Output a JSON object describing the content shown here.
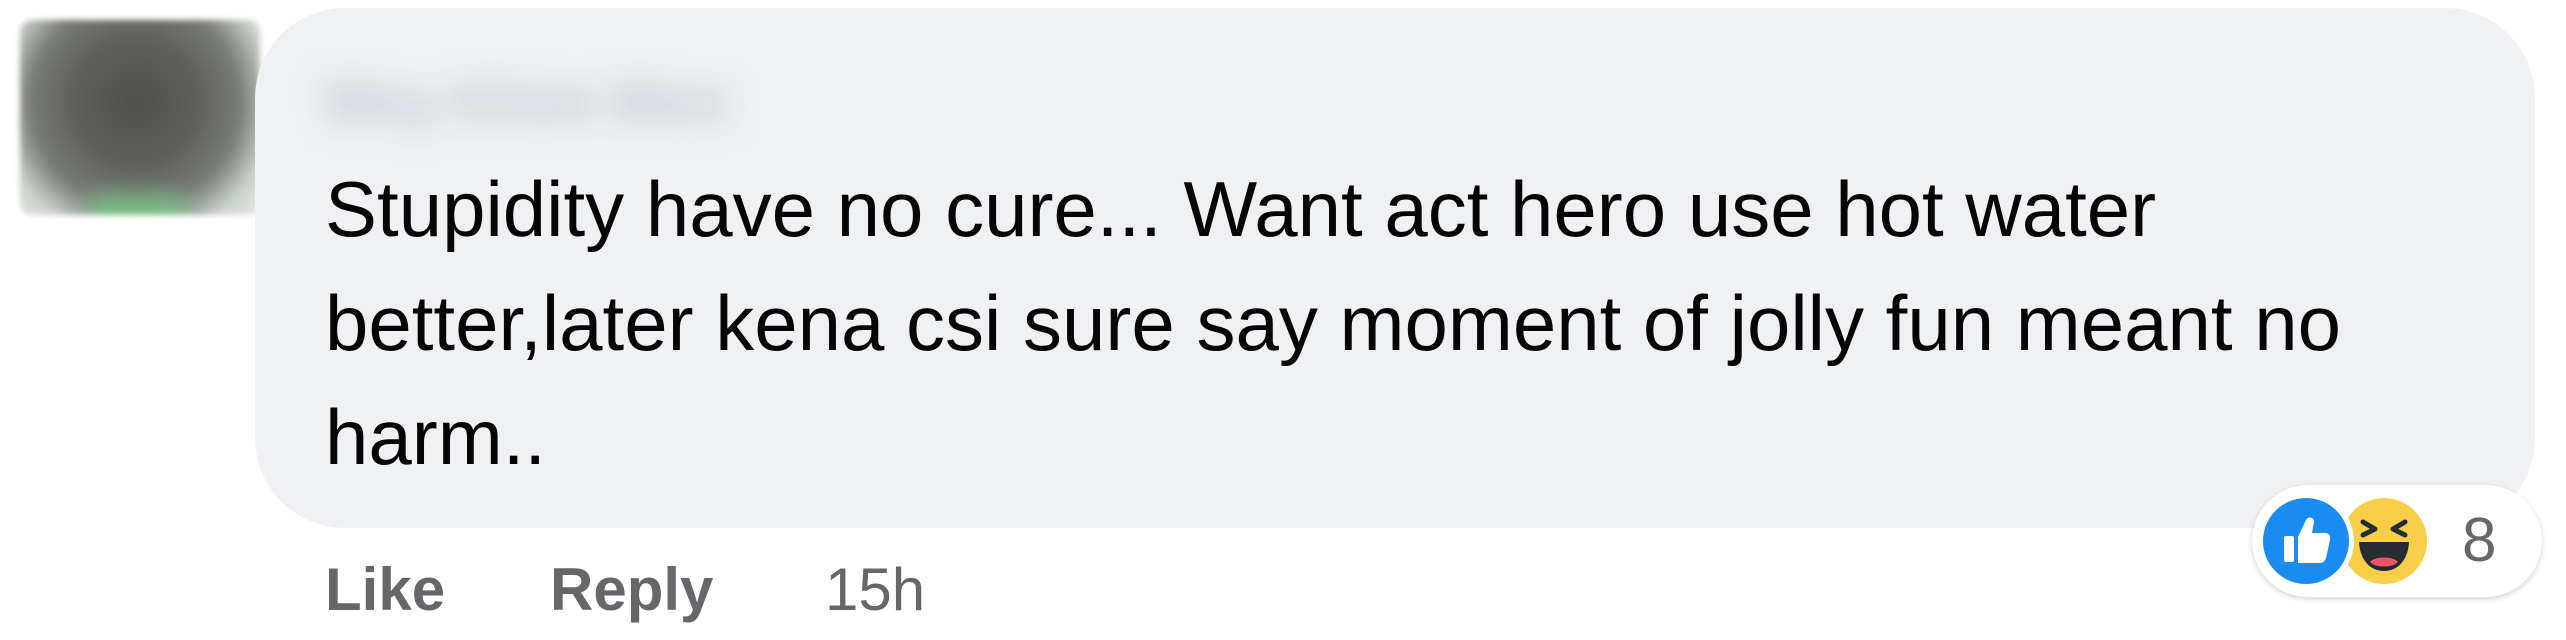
{
  "comment": {
    "author_name": "Wey Khim Wen",
    "text": "Stupidity have no cure... Want act hero use hot water better,later kena csi sure say moment of jolly fun meant no harm..",
    "actions": {
      "like_label": "Like",
      "reply_label": "Reply",
      "timestamp": "15h"
    },
    "reactions": {
      "types": [
        "like-icon",
        "haha-icon"
      ],
      "count": "8"
    }
  },
  "colors": {
    "bubble": "#eff1f4",
    "text": "#050505",
    "secondary_text": "#65676b",
    "like_blue": "#1b8cf2",
    "haha_yellow": "#f9cf4a"
  }
}
